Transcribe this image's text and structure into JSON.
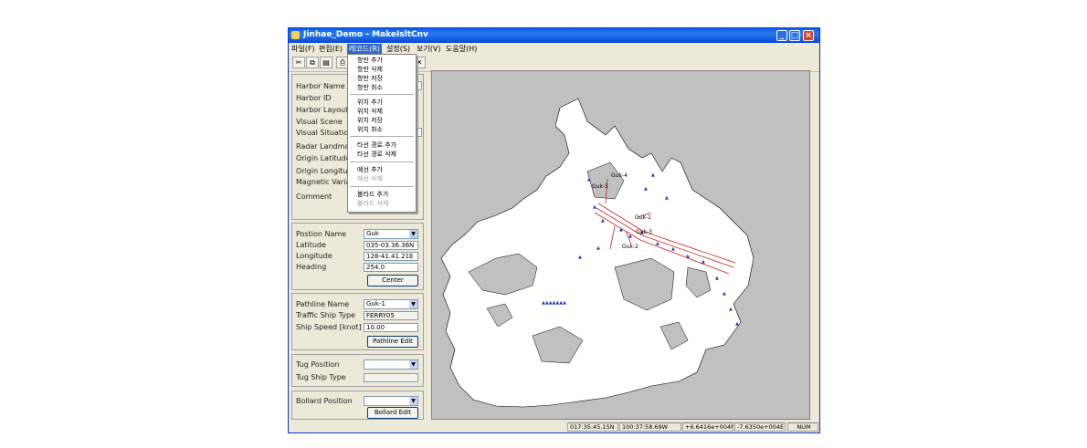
{
  "window": {
    "title": "Jinhae_Demo - MakeIsltCnv"
  },
  "menu": {
    "file": "파일(F)",
    "edit": "편집(E)",
    "record": "레코드(R)",
    "settings": "설정(S)",
    "view": "보기(V)",
    "help": "도움말(H)"
  },
  "popup_menu": {
    "items": [
      "항만 추가",
      "항만 삭제",
      "항만 저장",
      "항만 취소",
      "위치 추가",
      "위치 삭제",
      "위치 저장",
      "위치 취소",
      "타선 경로 추가",
      "타선 경로 삭제",
      "예선 추가",
      "예선 삭제",
      "볼라드 추가",
      "볼라드 삭제"
    ]
  },
  "harbor_panel": {
    "labels": [
      "Harbor Name",
      "Harbor ID",
      "Harbor Layout",
      "Visual Scene",
      "Visual Situation",
      "Radar Landmas",
      "Origin Latitude",
      "Origin Longitude",
      "Magnetic Variat",
      "Comment"
    ]
  },
  "position_panel": {
    "position_name_label": "Postion Name",
    "position_name_value": "Guk",
    "latitude_label": "Latitude",
    "latitude_value": "035-03.36.36N",
    "longitude_label": "Longitude",
    "longitude_value": "128-41.41.21E",
    "heading_label": "Heading",
    "heading_value": "254.0",
    "center_button": "Center"
  },
  "pathline_panel": {
    "name_label": "Pathline Name",
    "name_value": "Guk-1",
    "traffic_label": "Traffic Ship Type",
    "traffic_value": "FERRY05",
    "speed_label": "Ship Speed [knot]",
    "speed_value": "10.00",
    "edit_button": "Pathline Edit"
  },
  "tug_panel": {
    "position_label": "Tug Position",
    "position_value": "",
    "type_label": "Tug Ship Type",
    "type_value": ""
  },
  "bollard_panel": {
    "position_label": "Bollard Position",
    "position_value": "",
    "edit_button": "Bollard Edit"
  },
  "map": {
    "labels": [
      "Guk-5",
      "Guk-4",
      "Guk-1",
      "Guk-2",
      "Guk-3"
    ],
    "colors": {
      "sea": "#ffffff",
      "land": "#c0c0c0",
      "route": "#cc2222",
      "marker": "#2233cc"
    }
  },
  "statusbar": {
    "lat": "017:35:45.15N",
    "lon": "100:37:58.69W",
    "north": "+6.6416e+004N",
    "east": "-7.6350e+004E",
    "mode": "NUM"
  }
}
